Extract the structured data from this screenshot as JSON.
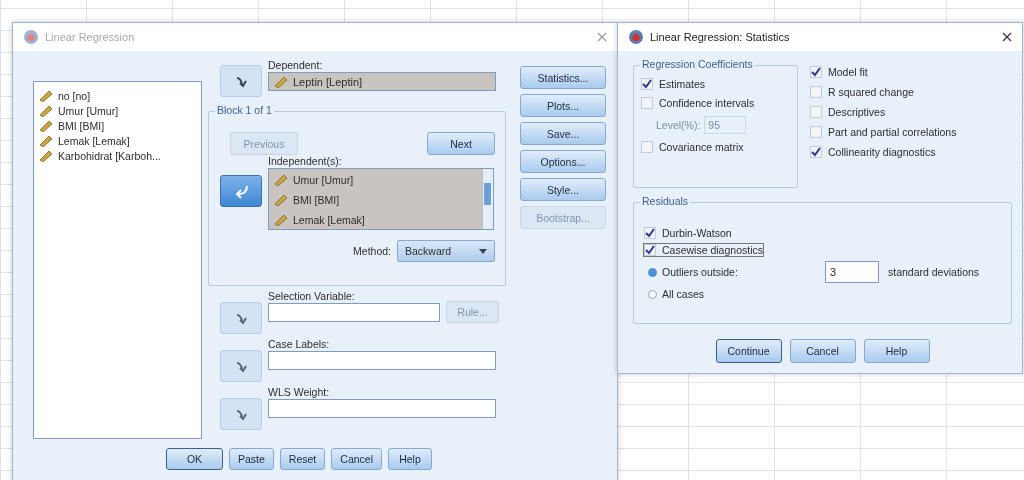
{
  "main_dialog": {
    "title": "Linear Regression",
    "active": false,
    "variables": [
      "no [no]",
      "Umur [Umur]",
      "BMI [BMI]",
      "Lemak [Lemak]",
      "Karbohidrat [Karboh..."
    ],
    "dependent": {
      "label": "Dependent:",
      "value": "Leptin [Leptin]",
      "move_highlighted": false
    },
    "block": {
      "title": "Block 1 of 1",
      "buttons": [
        {
          "label": "Previous",
          "disabled": true
        },
        {
          "label": "Next",
          "disabled": false
        }
      ]
    },
    "independents": {
      "label": "Independent(s):",
      "items": [
        "Umur [Umur]",
        "BMI [BMI]",
        "Lemak [Lemak]"
      ],
      "move_highlighted": true
    },
    "method": {
      "label": "Method:",
      "value": "Backward"
    },
    "selection_variable": {
      "label": "Selection Variable:",
      "move_highlighted": false,
      "rule_button": {
        "label": "Rule...",
        "disabled": true
      }
    },
    "case_labels": {
      "label": "Case Labels:",
      "move_highlighted": false
    },
    "wls_weight": {
      "label": "WLS Weight:",
      "move_highlighted": false
    },
    "side_buttons": [
      {
        "label": "Statistics...",
        "disabled": false
      },
      {
        "label": "Plots...",
        "disabled": false
      },
      {
        "label": "Save...",
        "disabled": false
      },
      {
        "label": "Options...",
        "disabled": false
      },
      {
        "label": "Style...",
        "disabled": false
      },
      {
        "label": "Bootstrap...",
        "disabled": true
      }
    ],
    "buttons": [
      "OK",
      "Paste",
      "Reset",
      "Cancel",
      "Help"
    ]
  },
  "statistics_dialog": {
    "title": "Linear Regression: Statistics",
    "active": true,
    "coefficients": {
      "title": "Regression Coefficients",
      "items": [
        {
          "kind": "checkbox",
          "label": "Estimates",
          "checked": true
        },
        {
          "kind": "checkbox",
          "label": "Confidence intervals",
          "checked": false
        },
        {
          "kind": "level",
          "label": "Level(%):",
          "value": "95",
          "disabled": true
        },
        {
          "kind": "checkbox",
          "label": "Covariance matrix",
          "checked": false
        }
      ]
    },
    "other_options": [
      {
        "label": "Model fit",
        "checked": true
      },
      {
        "label": "R squared change",
        "checked": false
      },
      {
        "label": "Descriptives",
        "checked": false
      },
      {
        "label": "Part and partial correlations",
        "checked": false
      },
      {
        "label": "Collinearity diagnostics",
        "checked": true
      }
    ],
    "residuals": {
      "title": "Residuals",
      "options": [
        {
          "label": "Durbin-Watson",
          "checked": true,
          "focused": false
        },
        {
          "label": "Casewise diagnostics",
          "checked": true,
          "focused": true
        }
      ],
      "radios": [
        {
          "label": "Outliers outside:",
          "selected": true,
          "value": "3",
          "unit": "standard deviations"
        },
        {
          "label": "All cases",
          "selected": false
        }
      ]
    },
    "buttons": [
      "Continue",
      "Cancel",
      "Help"
    ]
  }
}
